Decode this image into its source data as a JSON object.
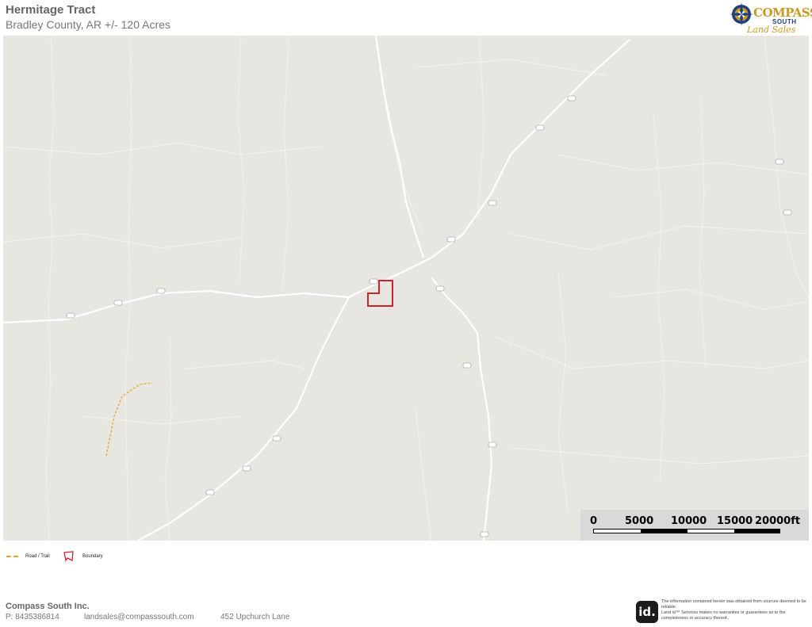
{
  "header": {
    "title": "Hermitage Tract",
    "subtitle": "Bradley County, AR +/- 120 Acres"
  },
  "logo": {
    "line1": "COMPASS",
    "line2": "SOUTH",
    "line3": "Land Sales"
  },
  "scale_bar": {
    "labels": [
      "0",
      "5000",
      "10000",
      "15000",
      "20000ft"
    ]
  },
  "legend": {
    "items": [
      {
        "label": "Road / Trail",
        "icon": "dashed-line-icon",
        "color": "#e8a317"
      },
      {
        "label": "Boundary",
        "icon": "polygon-outline-icon",
        "color": "#d0202a"
      }
    ]
  },
  "footer": {
    "company": "Compass South Inc.",
    "phone": "P: 8435386814",
    "email": "landsales@compasssouth.com",
    "address": "452 Upchurch Lane"
  },
  "disclaimer": {
    "badge": "id.",
    "lines": [
      "The information contained herein was obtained from sources deemed to be reliable.",
      "Land id™ Services makes no warranties or guarantees as to the completeness or accuracy thereof."
    ]
  },
  "colors": {
    "map_background": "#e8e6e1",
    "road": "#ffffff",
    "boundary": "#d0202a",
    "trail": "#e8a317"
  }
}
